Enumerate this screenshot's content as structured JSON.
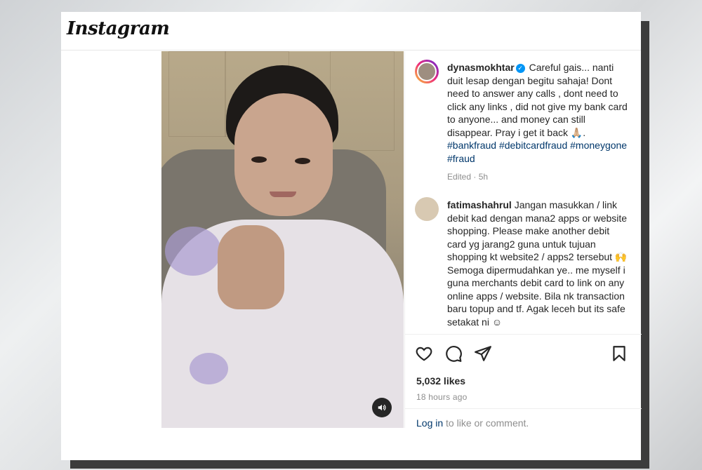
{
  "header": {
    "logo_text": "Instagram"
  },
  "post": {
    "author": {
      "username": "dynasmokhtar",
      "caption_segments": [
        "Careful gais... nanti duit lesap dengan begitu sahaja! Dont need to answer any calls , dont need to click any links , did not give my bank card to anyone... and money can still disappear. Pray i get it back 🙏🏼."
      ],
      "hashtags": [
        "#bankfraud",
        "#debitcardfraud",
        "#moneygone",
        "#fraud"
      ],
      "edited_meta": "Edited · 5h"
    },
    "comment": {
      "username": "fatimashahrul",
      "text": "Jangan masukkan / link debit kad dengan mana2 apps or website shopping. Please make another debit card yg jarang2 guna untuk tujuan shopping kt website2 / apps2 tersebut 🙌 Semoga dipermudahkan ye.. me myself i guna merchants debit card to link on any online apps / website. Bila nk transaction baru topup and tf. Agak leceh but its safe setakat ni ☺"
    },
    "likes": "5,032 likes",
    "posted_time": "18 hours ago",
    "login_link": "Log in",
    "login_suffix": " to like or comment.",
    "icons": {
      "like": "heart-icon",
      "comment": "comment-icon",
      "share": "share-icon",
      "save": "bookmark-icon",
      "sound": "speaker-icon",
      "verified": "verified-icon"
    }
  }
}
